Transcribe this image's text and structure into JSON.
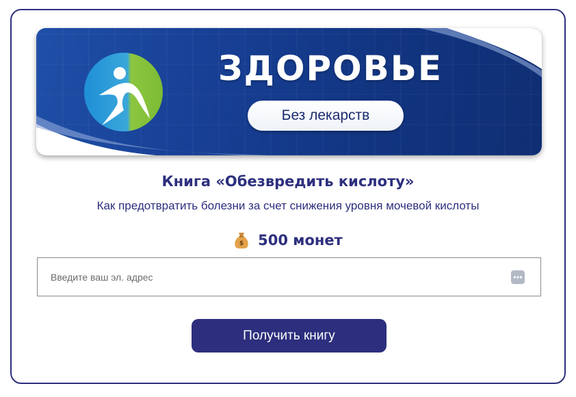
{
  "banner": {
    "title": "ЗДОРОВЬЕ",
    "pill_label": "Без лекарств",
    "logo_icon": "running-person-logo-icon"
  },
  "book": {
    "title": "Книга «Обезвредить кислоту»",
    "subtitle": "Как предотвратить болезни за счет снижения уровня мочевой кислоты"
  },
  "price": {
    "icon": "money-bag-icon",
    "amount": "500 монет"
  },
  "email": {
    "placeholder": "Введите ваш эл. адрес",
    "value": "",
    "autofill_icon": "autofill-dots-icon"
  },
  "submit": {
    "label": "Получить книгу"
  },
  "colors": {
    "accent": "#2d2f7e",
    "banner_blue": "#173f94",
    "logo_blue": "#1f8fd8",
    "logo_green": "#8cc63f"
  }
}
